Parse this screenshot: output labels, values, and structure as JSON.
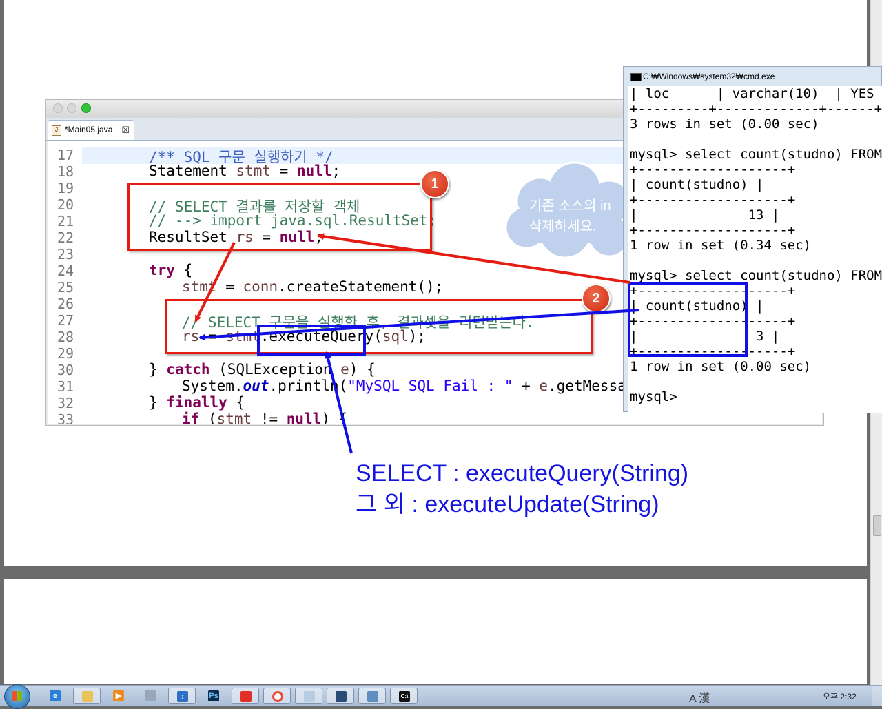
{
  "editor": {
    "tab_label": "*Main05.java",
    "tab_close": "☒",
    "line_numbers": [
      "17",
      "18",
      "19",
      "20",
      "21",
      "22",
      "23",
      "24",
      "25",
      "26",
      "27",
      "28",
      "29",
      "30",
      "31",
      "32",
      "33"
    ],
    "code": {
      "l17": "/** SQL 구문 실행하기 */",
      "l18_type": "Statement ",
      "l18_var": "stmt",
      "l18_eq": " = ",
      "l18_null": "null",
      "l18_end": ";",
      "l20": "// SELECT 결과를 저장할 객체",
      "l21": "// --> import java.sql.ResultSet;",
      "l22_type": "ResultSet ",
      "l22_var": "rs",
      "l22_eq": " = ",
      "l22_null": "null",
      "l22_end": ";",
      "l24_try": "try",
      "l24_brace": " {",
      "l25_var": "stmt",
      "l25_eq": " = ",
      "l25_conn": "conn",
      "l25_call": ".createStatement();",
      "l27": "// SELECT 구문을 실행한 후, 결과셋을 리턴받는다.",
      "l28_var": "rs",
      "l28_eq": " = ",
      "l28_stmt": "stmt",
      "l28_dot": ".",
      "l28_method": "executeQuery",
      "l28_open": "(",
      "l28_arg": "sql",
      "l28_close": ");",
      "l30_brace": "} ",
      "l30_catch": "catch",
      "l30_rest1": " (SQLException ",
      "l30_e": "e",
      "l30_rest2": ") {",
      "l31_sys": "System.",
      "l31_out": "out",
      "l31_println": ".println(",
      "l31_str": "\"MySQL SQL Fail : \"",
      "l31_plus": " + ",
      "l31_e": "e",
      "l31_get": ".getMessage(",
      "l32_brace": "} ",
      "l32_finally": "finally",
      "l32_open": " {",
      "l33_if": "if",
      "l33_open": " (",
      "l33_stmt": "stmt",
      "l33_ne": " != ",
      "l33_null": "null",
      "l33_close": ") {"
    }
  },
  "cmd": {
    "title": "C:₩Windows₩system32₩cmd.exe",
    "lines": [
      "| loc      | varchar(10)  | YES   |      ",
      "+---------+-------------+------+------",
      "3 rows in set (0.00 sec)",
      "",
      "mysql> select count(studno) FROM stud",
      "+-------------------+",
      "| count(studno) |",
      "+-------------------+",
      "|              13 |",
      "+-------------------+",
      "1 row in set (0.34 sec)",
      "",
      "mysql> select count(studno) FROM stud",
      "+-------------------+",
      "| count(studno) |",
      "+-------------------+",
      "|               3 |",
      "+-------------------+",
      "1 row in set (0.00 sec)",
      "",
      "mysql>"
    ]
  },
  "annotations": {
    "badge1": "1",
    "badge2": "2",
    "cloud_line1": "기존 소스의 in",
    "cloud_line2": "삭제하세요.",
    "note_line1": "SELECT : executeQuery(String)",
    "note_line2": "그 외 : executeUpdate(String)"
  },
  "taskbar": {
    "tray_ime": "A 漢",
    "clock": "오후 2:32"
  },
  "colors": {
    "annotation_red": "#e41c12",
    "annotation_blue": "#1010e6",
    "comment_blue": "#3f5fbf",
    "comment_green": "#3f7f5f",
    "keyword": "#7f0055",
    "string": "#2a00ff"
  }
}
